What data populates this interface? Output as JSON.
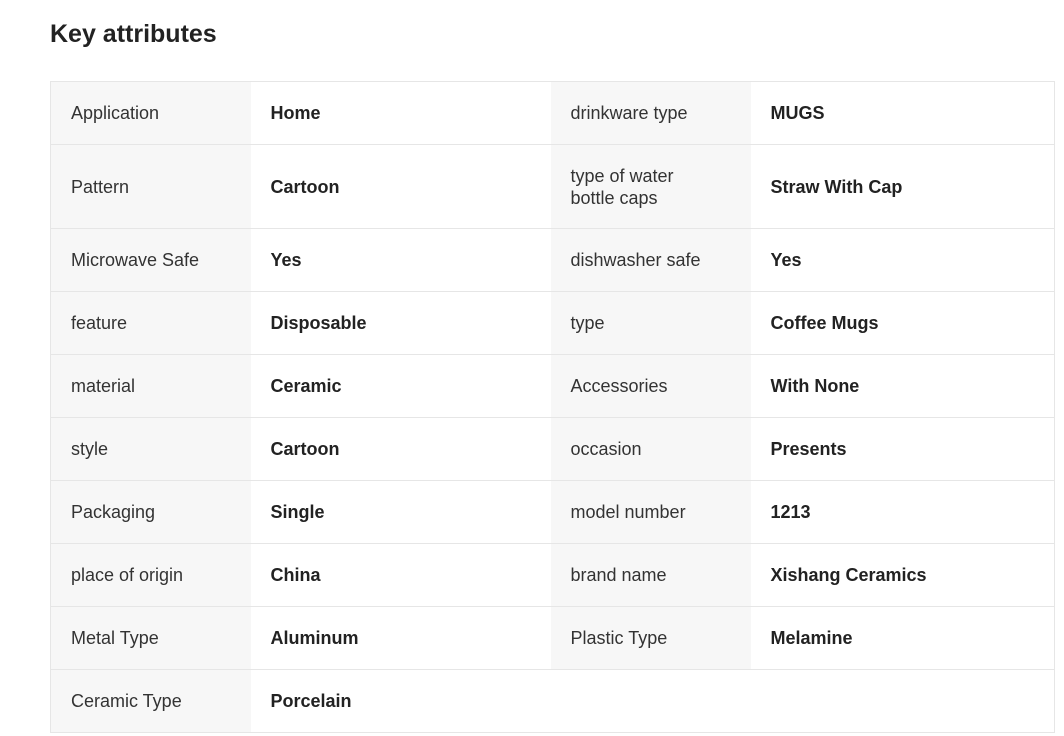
{
  "section": {
    "title": "Key attributes"
  },
  "rows": [
    {
      "l1": "Application",
      "v1": "Home",
      "l2": "drinkware type",
      "v2": "MUGS"
    },
    {
      "l1": "Pattern",
      "v1": "Cartoon",
      "l2": "type of water bottle caps",
      "v2": "Straw With Cap"
    },
    {
      "l1": "Microwave Safe",
      "v1": "Yes",
      "l2": "dishwasher safe",
      "v2": "Yes"
    },
    {
      "l1": "feature",
      "v1": "Disposable",
      "l2": "type",
      "v2": "Coffee Mugs"
    },
    {
      "l1": "material",
      "v1": "Ceramic",
      "l2": "Accessories",
      "v2": "With None"
    },
    {
      "l1": "style",
      "v1": "Cartoon",
      "l2": "occasion",
      "v2": "Presents"
    },
    {
      "l1": "Packaging",
      "v1": "Single",
      "l2": "model number",
      "v2": "1213"
    },
    {
      "l1": "place of origin",
      "v1": "China",
      "l2": "brand name",
      "v2": "Xishang Ceramics"
    },
    {
      "l1": "Metal Type",
      "v1": "Aluminum",
      "l2": "Plastic Type",
      "v2": "Melamine"
    },
    {
      "l1": "Ceramic Type",
      "v1": "Porcelain"
    }
  ]
}
